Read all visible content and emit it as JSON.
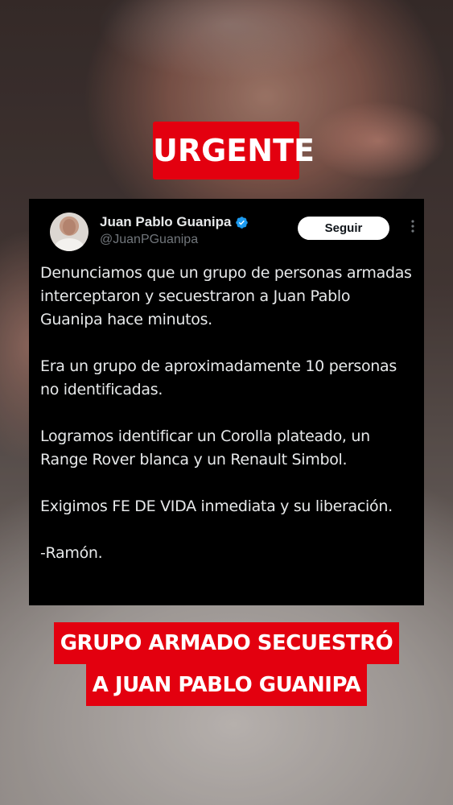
{
  "overlay": {
    "top_badge": "URGENTE",
    "headline_lines": [
      "GRUPO ARMADO SECUESTRÓ",
      "A JUAN PABLO GUANIPA"
    ]
  },
  "tweet": {
    "author_name": "Juan Pablo Guanipa",
    "handle": "@JuanPGuanipa",
    "follow_label": "Seguir",
    "more_icon": "more-vertical-icon",
    "verified_icon": "verified-badge-icon",
    "body": [
      "Denunciamos que un grupo de personas armadas interceptaron y secuestraron a Juan Pablo Guanipa hace minutos.",
      "Era un grupo de aproximadamente 10 personas no identificadas.",
      "Logramos identificar un Corolla plateado, un Range Rover blanca y un Renault Simbol.",
      "Exigimos FE DE VIDA inmediata y su liberación.",
      "-Ramón."
    ]
  },
  "colors": {
    "accent_red": "#e3000f",
    "tweet_bg": "#000000",
    "verified_blue": "#1d9bf0",
    "secondary_text": "#71767b"
  }
}
